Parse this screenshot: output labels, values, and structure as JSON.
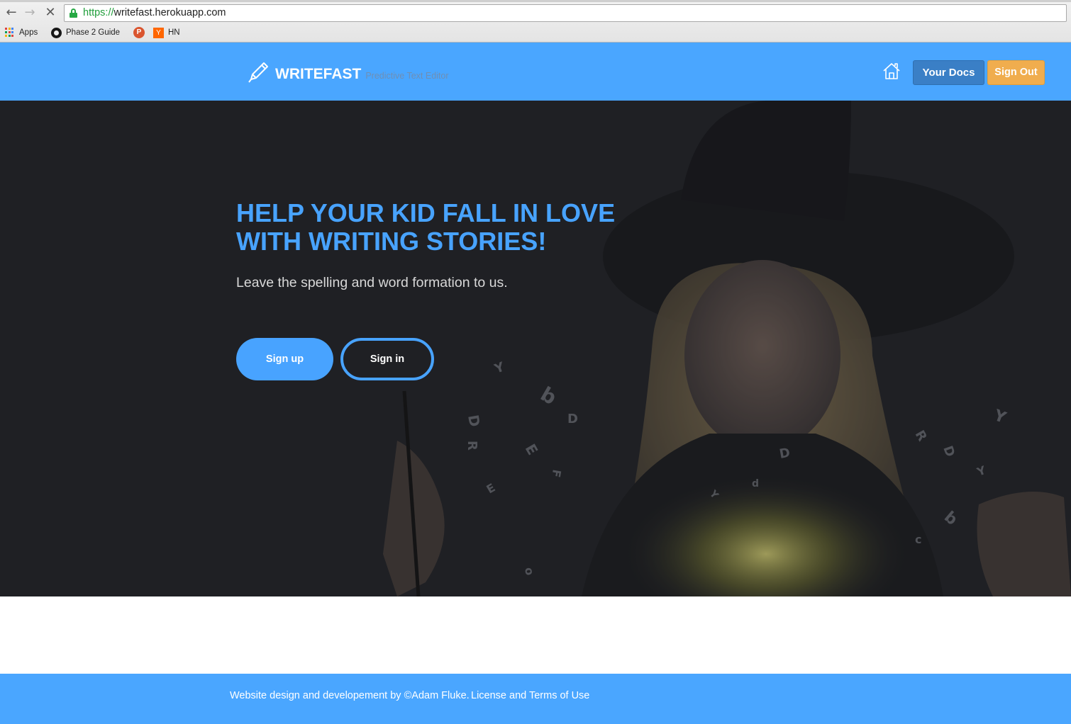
{
  "browser": {
    "url_scheme": "https://",
    "url_host": "writefast.herokuapp.com",
    "back_icon": "back-arrow-icon",
    "forward_icon": "forward-arrow-icon",
    "stop_icon": "stop-icon",
    "bookmarks": [
      {
        "label": "Apps",
        "icon": "apps-grid-icon"
      },
      {
        "label": "Phase 2 Guide",
        "icon": "github-icon"
      },
      {
        "label": "",
        "icon": "producthunt-icon",
        "glyph": "P"
      },
      {
        "label": "HN",
        "icon": "ycombinator-icon",
        "glyph": "Y"
      }
    ]
  },
  "header": {
    "brand": "WRITEFAST",
    "tagline": "Predictive Text Editor",
    "home_icon": "home-icon",
    "your_docs": "Your Docs",
    "sign_out": "Sign Out"
  },
  "hero": {
    "title_line1": "HELP YOUR KID FALL IN LOVE",
    "title_line2": "WITH WRITING STORIES!",
    "subtitle": "Leave the spelling and word formation to us.",
    "sign_up": "Sign up",
    "sign_in": "Sign in"
  },
  "footer": {
    "credit": "Website design and developement by ©Adam Fluke.",
    "license": "License and Terms of Use"
  },
  "colors": {
    "brand_blue": "#4aa6ff",
    "docs_button": "#3a7fc6",
    "signout_button": "#f0ad4e",
    "hero_bg": "#1f2125"
  }
}
